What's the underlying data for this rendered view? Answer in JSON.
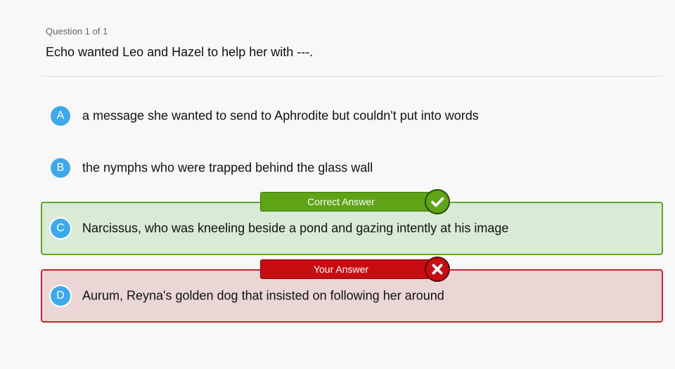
{
  "question": {
    "counter": "Question 1 of 1",
    "text": "Echo wanted Leo and Hazel to help her with ---."
  },
  "options": [
    {
      "letter": "A",
      "text": "a message she wanted to send to Aphrodite but couldn't put into words",
      "state": "neutral"
    },
    {
      "letter": "B",
      "text": "the nymphs who were trapped behind the glass wall",
      "state": "neutral"
    },
    {
      "letter": "C",
      "text": "Narcissus, who was kneeling beside a pond and gazing intently at his image",
      "state": "correct"
    },
    {
      "letter": "D",
      "text": "Aurum, Reyna's golden dog that insisted on following her around",
      "state": "selected-wrong"
    }
  ],
  "labels": {
    "correct_answer": "Correct Answer",
    "your_answer": "Your Answer"
  },
  "icons": {
    "correct": "check-icon",
    "wrong": "x-icon"
  },
  "colors": {
    "letter_badge": "#3da9ea",
    "correct_border": "#5fa82a",
    "correct_fill": "#d9ead6",
    "correct_tag": "#5fa317",
    "wrong_border": "#c8232c",
    "wrong_fill": "#ebd6d6",
    "wrong_tag": "#c80d12"
  }
}
